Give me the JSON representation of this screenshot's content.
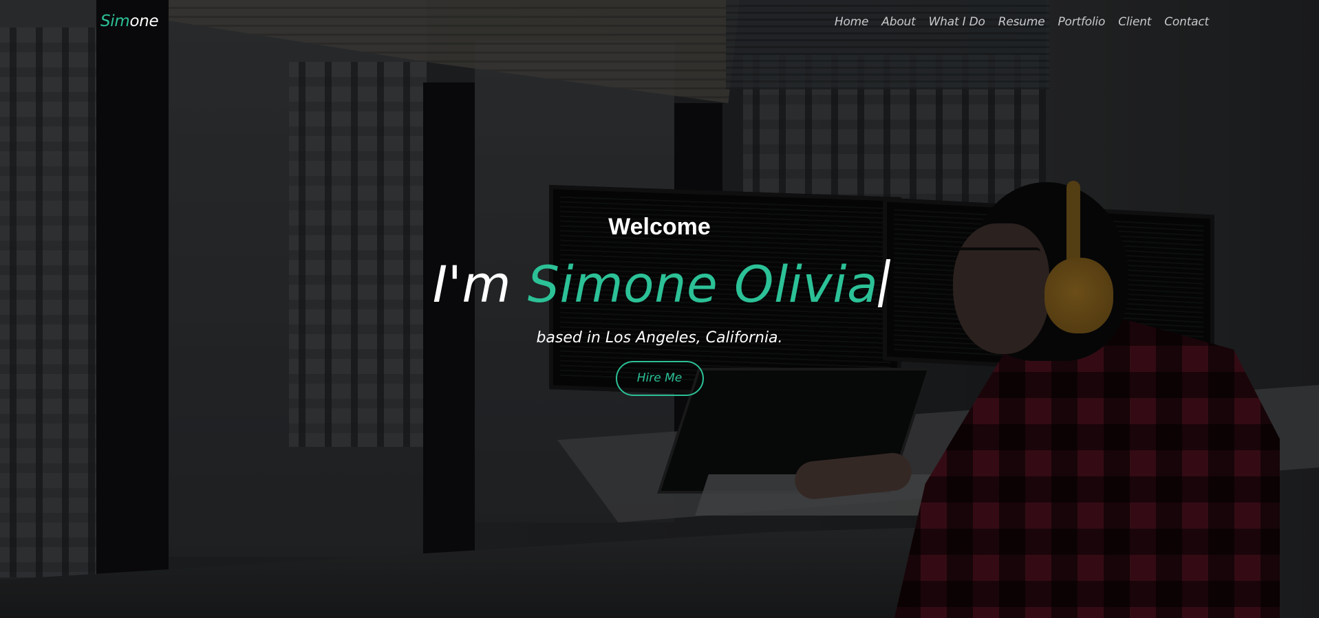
{
  "brand": {
    "logo_accent": "Sim",
    "logo_rest": "one"
  },
  "nav": {
    "items": [
      {
        "label": "Home"
      },
      {
        "label": "About"
      },
      {
        "label": "What I Do"
      },
      {
        "label": "Resume"
      },
      {
        "label": "Portfolio"
      },
      {
        "label": "Client"
      },
      {
        "label": "Contact"
      }
    ]
  },
  "hero": {
    "welcome": "Welcome",
    "headline_prefix": "I'm ",
    "headline_name": "Simone Olivia",
    "tagline": "based in Los Angeles, California.",
    "cta_label": "Hire Me"
  },
  "theme": {
    "accent": "#2cc197",
    "text": "#ffffff",
    "nav_text": "#c8c9ca"
  }
}
